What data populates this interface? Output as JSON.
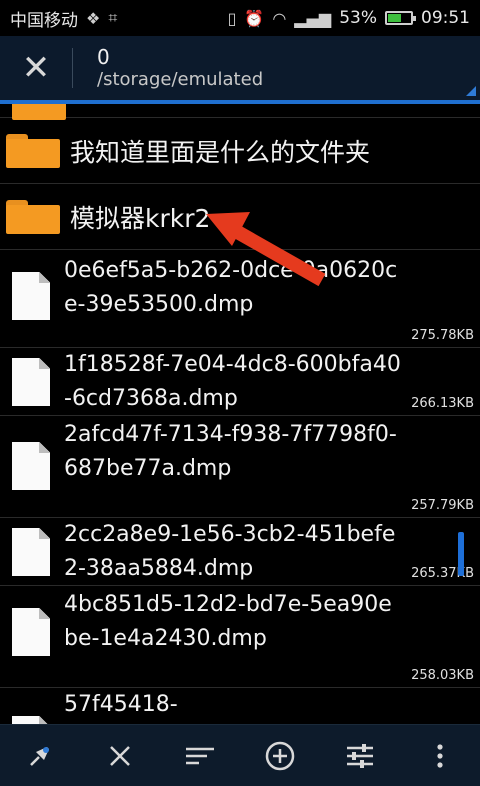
{
  "status_bar": {
    "carrier": "中国移动",
    "battery": "53%",
    "battery_level": 0.53,
    "time": "09:51"
  },
  "header": {
    "title": "0",
    "path": "/storage/emulated"
  },
  "folders": [
    {
      "name": "我知道里面是什么的文件夹"
    },
    {
      "name": "模拟器krkr2"
    }
  ],
  "files": [
    {
      "name": "0e6ef5a5-b262-0dce-0a0620ce-39e53500.dmp",
      "size": "275.78KB"
    },
    {
      "name": "1f18528f-7e04-4dc8-600bfa40-6cd7368a.dmp",
      "size": "266.13KB"
    },
    {
      "name": "2afcd47f-7134-f938-7f7798f0-687be77a.dmp",
      "size": "257.79KB"
    },
    {
      "name": "2cc2a8e9-1e56-3cb2-451befe2-38aa5884.dmp",
      "size": "265.37KB"
    },
    {
      "name": "4bc851d5-12d2-bd7e-5ea90ebe-1e4a2430.dmp",
      "size": "258.03KB"
    },
    {
      "name": "57f45418-",
      "size": ""
    }
  ],
  "colors": {
    "header_bg": "#0c1a2c",
    "accent": "#1f6fd0",
    "folder": "#f49a22",
    "arrow": "#e53a1e"
  },
  "icons": [
    "close-icon",
    "folder-icon",
    "file-icon",
    "pin-icon",
    "sort-icon",
    "add-icon",
    "settings-sliders-icon",
    "more-icon"
  ]
}
